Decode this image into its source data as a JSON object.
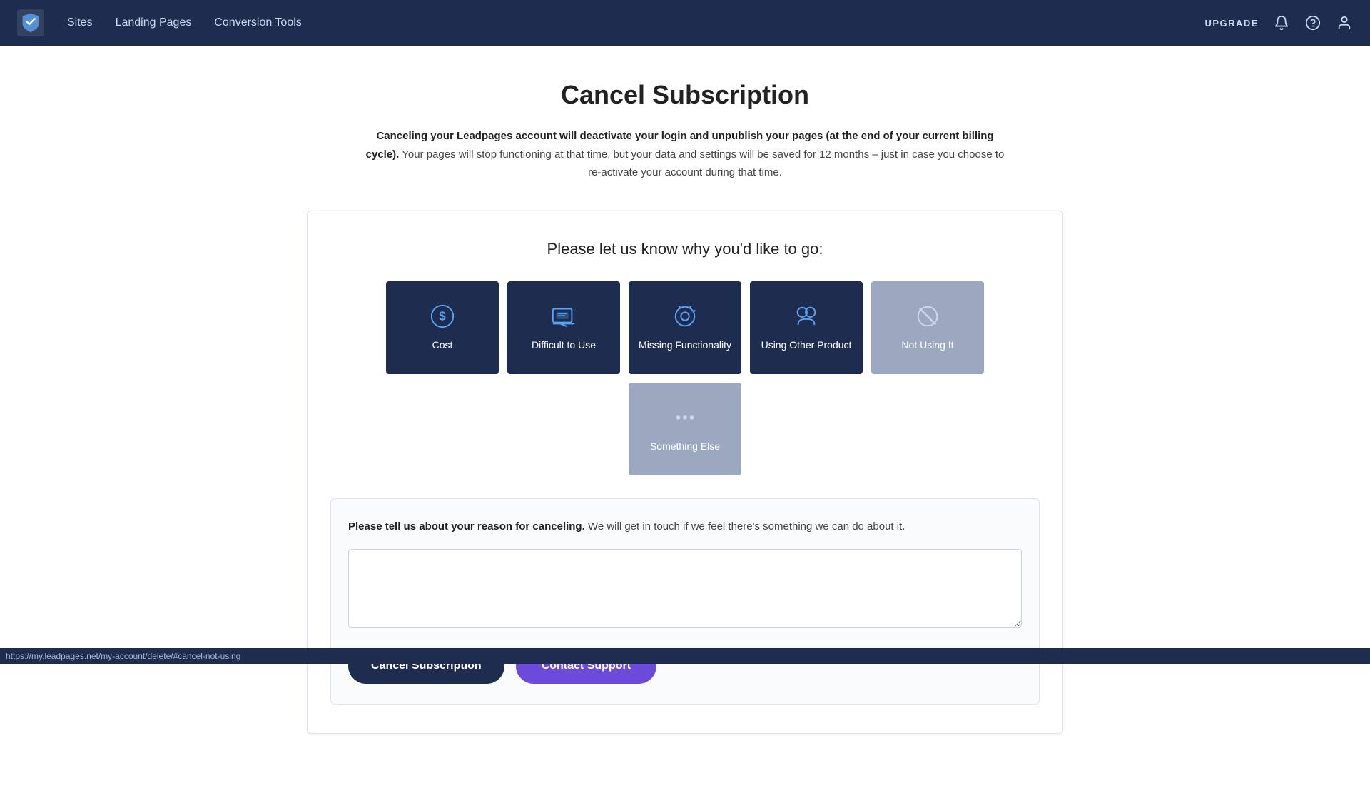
{
  "nav": {
    "logo_alt": "Leadpages logo",
    "links": [
      "Sites",
      "Landing Pages",
      "Conversion Tools"
    ],
    "upgrade_label": "Upgrade",
    "icons": {
      "bell": "🔔",
      "help": "❓",
      "user": "👤"
    }
  },
  "page": {
    "title": "Cancel Subscription",
    "subtitle_bold": "Canceling your Leadpages account will deactivate your login and unpublish your pages (at the end of your current billing cycle).",
    "subtitle_rest": " Your pages will stop functioning at that time, but your data and settings will be saved for 12 months – just in case you choose to re-activate your account during that time."
  },
  "card": {
    "heading": "Please let us know why you'd like to go:",
    "reasons": [
      {
        "id": "cost",
        "label": "Cost",
        "icon": "cost"
      },
      {
        "id": "difficult",
        "label": "Difficult to Use",
        "icon": "difficult"
      },
      {
        "id": "missing",
        "label": "Missing Functionality",
        "icon": "missing"
      },
      {
        "id": "other-product",
        "label": "Using Other Product",
        "icon": "other-product"
      },
      {
        "id": "not-using",
        "label": "Not Using It",
        "icon": "not-using",
        "muted": true
      },
      {
        "id": "something-else",
        "label": "Something Else",
        "icon": "something-else",
        "muted": true
      }
    ],
    "feedback": {
      "prompt_bold": "Please tell us about your reason for canceling.",
      "prompt_rest": " We will get in touch if we feel there's something we can do about it.",
      "textarea_placeholder": ""
    },
    "buttons": {
      "cancel_label": "Cancel Subscription",
      "contact_label": "Contact Support"
    }
  },
  "status_bar": {
    "url": "https://my.leadpages.net/my-account/delete/#cancel-not-using"
  }
}
